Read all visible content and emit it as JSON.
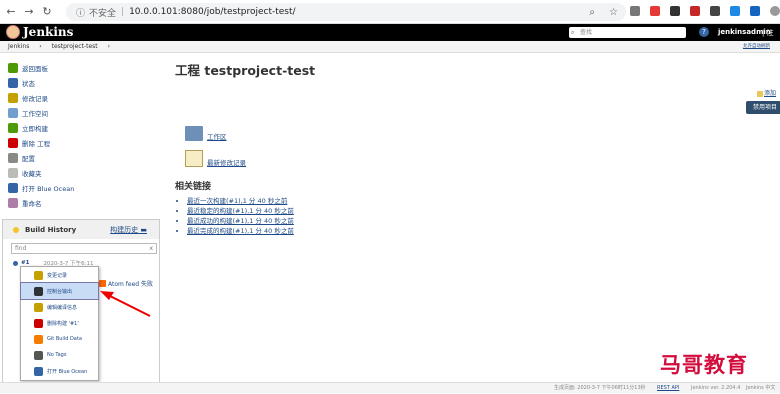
{
  "browser": {
    "security_label": "不安全",
    "url": "10.0.0.101:8080/job/testproject-test/"
  },
  "header": {
    "app_name": "Jenkins",
    "search_placeholder": "查找",
    "help": "?",
    "user": "jenkinsadmin",
    "logout": "| 注"
  },
  "breadcrumb": {
    "root": "Jenkins",
    "job": "testproject-test",
    "auto_refresh": "允许自动刷新"
  },
  "sidebar": {
    "items": [
      {
        "label": "返回面板",
        "color": "#4e9a06"
      },
      {
        "label": "状态",
        "color": "#3465a4"
      },
      {
        "label": "修改记录",
        "color": "#c4a000"
      },
      {
        "label": "工作空间",
        "color": "#729fcf"
      },
      {
        "label": "立即构建",
        "color": "#4e9a06"
      },
      {
        "label": "删除 工程",
        "color": "#cc0000"
      },
      {
        "label": "配置",
        "color": "#888a85"
      },
      {
        "label": "收藏夹",
        "color": "#babdb6"
      },
      {
        "label": "打开 Blue Ocean",
        "color": "#3465a4"
      },
      {
        "label": "重命名",
        "color": "#ad7fa8"
      }
    ]
  },
  "build_history": {
    "title": "Build History",
    "trend": "构建历史 ▬",
    "find_placeholder": "find",
    "clear": "x",
    "build_number": "#1",
    "build_date": "2020-3-7 下午6:11",
    "feed": "Atom feed 失败"
  },
  "context_menu": {
    "items": [
      {
        "label": "变更记录",
        "color": "#c4a000"
      },
      {
        "label": "控制台输出",
        "color": "#2e3436"
      },
      {
        "label": "编辑编译信息",
        "color": "#c4a000"
      },
      {
        "label": "删除构建 '#1'",
        "color": "#cc0000"
      },
      {
        "label": "Git Build Data",
        "color": "#f57c00"
      },
      {
        "label": "No Tags",
        "color": "#555753"
      },
      {
        "label": "打开 Blue Ocean",
        "color": "#3465a4"
      }
    ]
  },
  "main": {
    "title": "工程 testproject-test",
    "workspace_link": "工作区",
    "changes_link": "最新修改记录",
    "related_title": "相关链接",
    "related_links": [
      "最近一次构建(#1),1 分 40 秒之前",
      "最近稳定的构建(#1),1 分 40 秒之前",
      "最近成功的构建(#1),1 分 40 秒之前",
      "最近完成的构建(#1),1 分 40 秒之前"
    ],
    "edit_description": "添加",
    "disable_button": "禁用项目"
  },
  "footer": {
    "generated": "生成页面: 2020-3-7 下午06时11分13秒",
    "api": "REST API",
    "version": "Jenkins ver. 2.204.4",
    "locale": "Jenkins 中文"
  },
  "watermark": "马哥教育"
}
